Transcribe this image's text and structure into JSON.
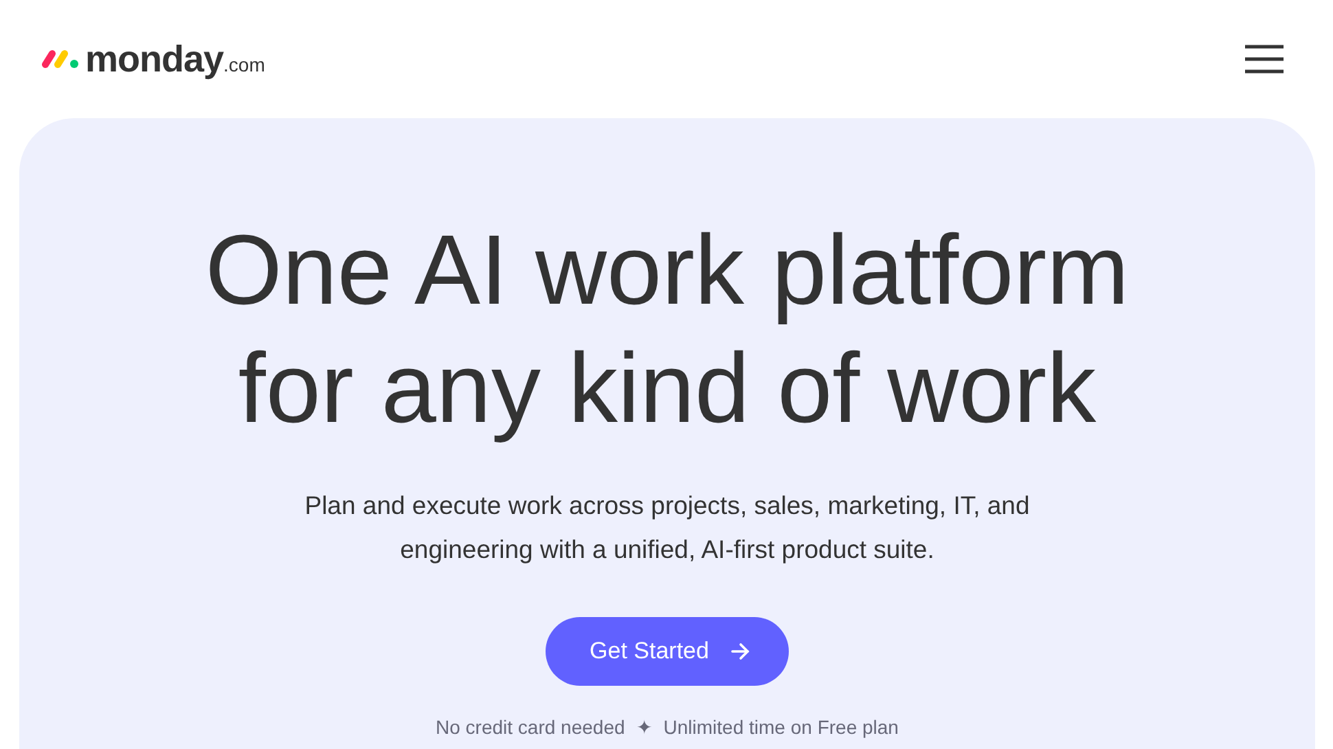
{
  "header": {
    "logo": {
      "name": "monday",
      "suffix": ".com"
    }
  },
  "hero": {
    "title_lines": [
      "One AI work platform",
      "for any kind of work"
    ],
    "subtitle": "Plan and execute work across projects, sales, marketing, IT, and engineering with a unified, AI-first product suite.",
    "button": {
      "label": "Get Started"
    },
    "notes": [
      "No credit card needed",
      "✦",
      "Unlimited time on Free plan"
    ]
  }
}
